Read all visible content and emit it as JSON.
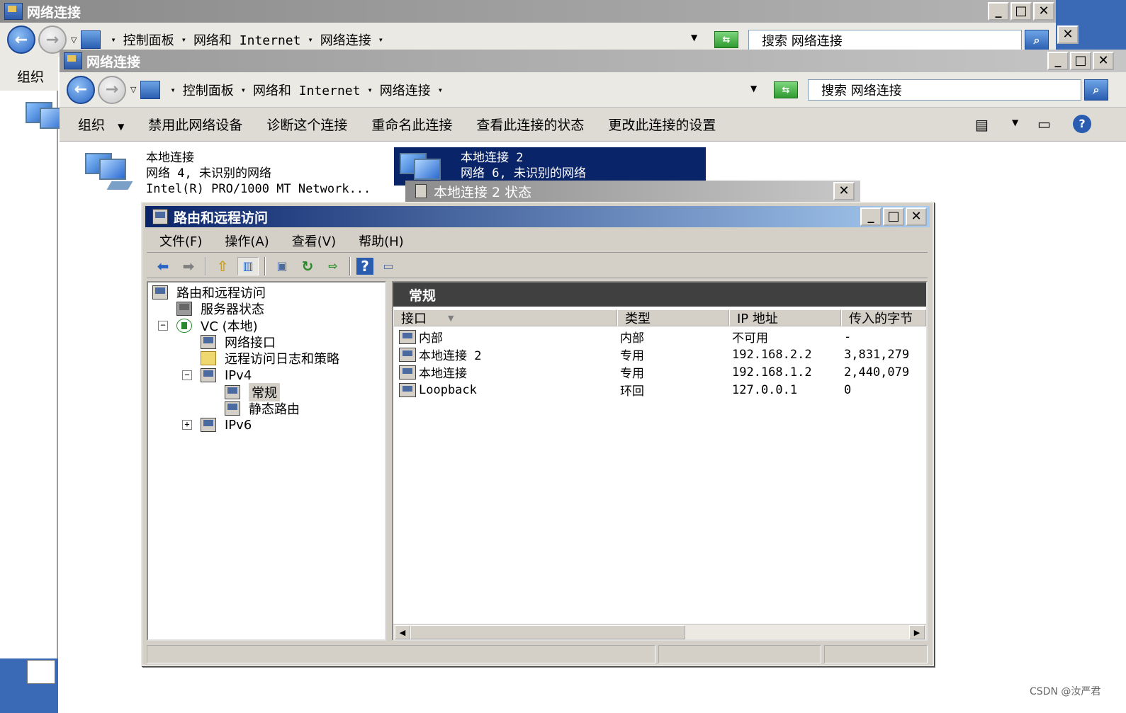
{
  "win1": {
    "title": "网络连接",
    "breadcrumb": [
      "控制面板",
      "网络和 Internet",
      "网络连接"
    ],
    "search_placeholder": "搜索 网络连接",
    "organize": "组织"
  },
  "win2": {
    "title": "网络连接",
    "breadcrumb": [
      "控制面板",
      "网络和 Internet",
      "网络连接"
    ],
    "search_placeholder": "搜索 网络连接",
    "toolbar": {
      "organize": "组织",
      "disable": "禁用此网络设备",
      "diagnose": "诊断这个连接",
      "rename": "重命名此连接",
      "view_status": "查看此连接的状态",
      "change_settings": "更改此连接的设置"
    },
    "connections": [
      {
        "name": "本地连接",
        "network": "网络  4, 未识别的网络",
        "adapter": "Intel(R) PRO/1000 MT Network..."
      },
      {
        "name": "本地连接 2",
        "network": "网络  6, 未识别的网络",
        "adapter": ""
      }
    ]
  },
  "status_dialog": {
    "title": "本地连接 2 状态"
  },
  "rras": {
    "title": "路由和远程访问",
    "menu": {
      "file": "文件(F)",
      "action": "操作(A)",
      "view": "查看(V)",
      "help": "帮助(H)"
    },
    "tree": {
      "root": "路由和远程访问",
      "server_status": "服务器状态",
      "server": "VC (本地)",
      "network_interfaces": "网络接口",
      "remote_access_logging": "远程访问日志和策略",
      "ipv4": "IPv4",
      "general": "常规",
      "static_routes": "静态路由",
      "ipv6": "IPv6"
    },
    "detail_title": "常规",
    "columns": [
      "接口",
      "类型",
      "IP 地址",
      "传入的字节"
    ],
    "rows": [
      {
        "interface": "内部",
        "type": "内部",
        "ip": "不可用",
        "bytes_in": "-"
      },
      {
        "interface": "本地连接 2",
        "type": "专用",
        "ip": "192.168.2.2",
        "bytes_in": "3,831,279"
      },
      {
        "interface": "本地连接",
        "type": "专用",
        "ip": "192.168.1.2",
        "bytes_in": "2,440,079"
      },
      {
        "interface": "Loopback",
        "type": "环回",
        "ip": "127.0.0.1",
        "bytes_in": "0"
      }
    ]
  },
  "watermark": "CSDN @汝严君"
}
